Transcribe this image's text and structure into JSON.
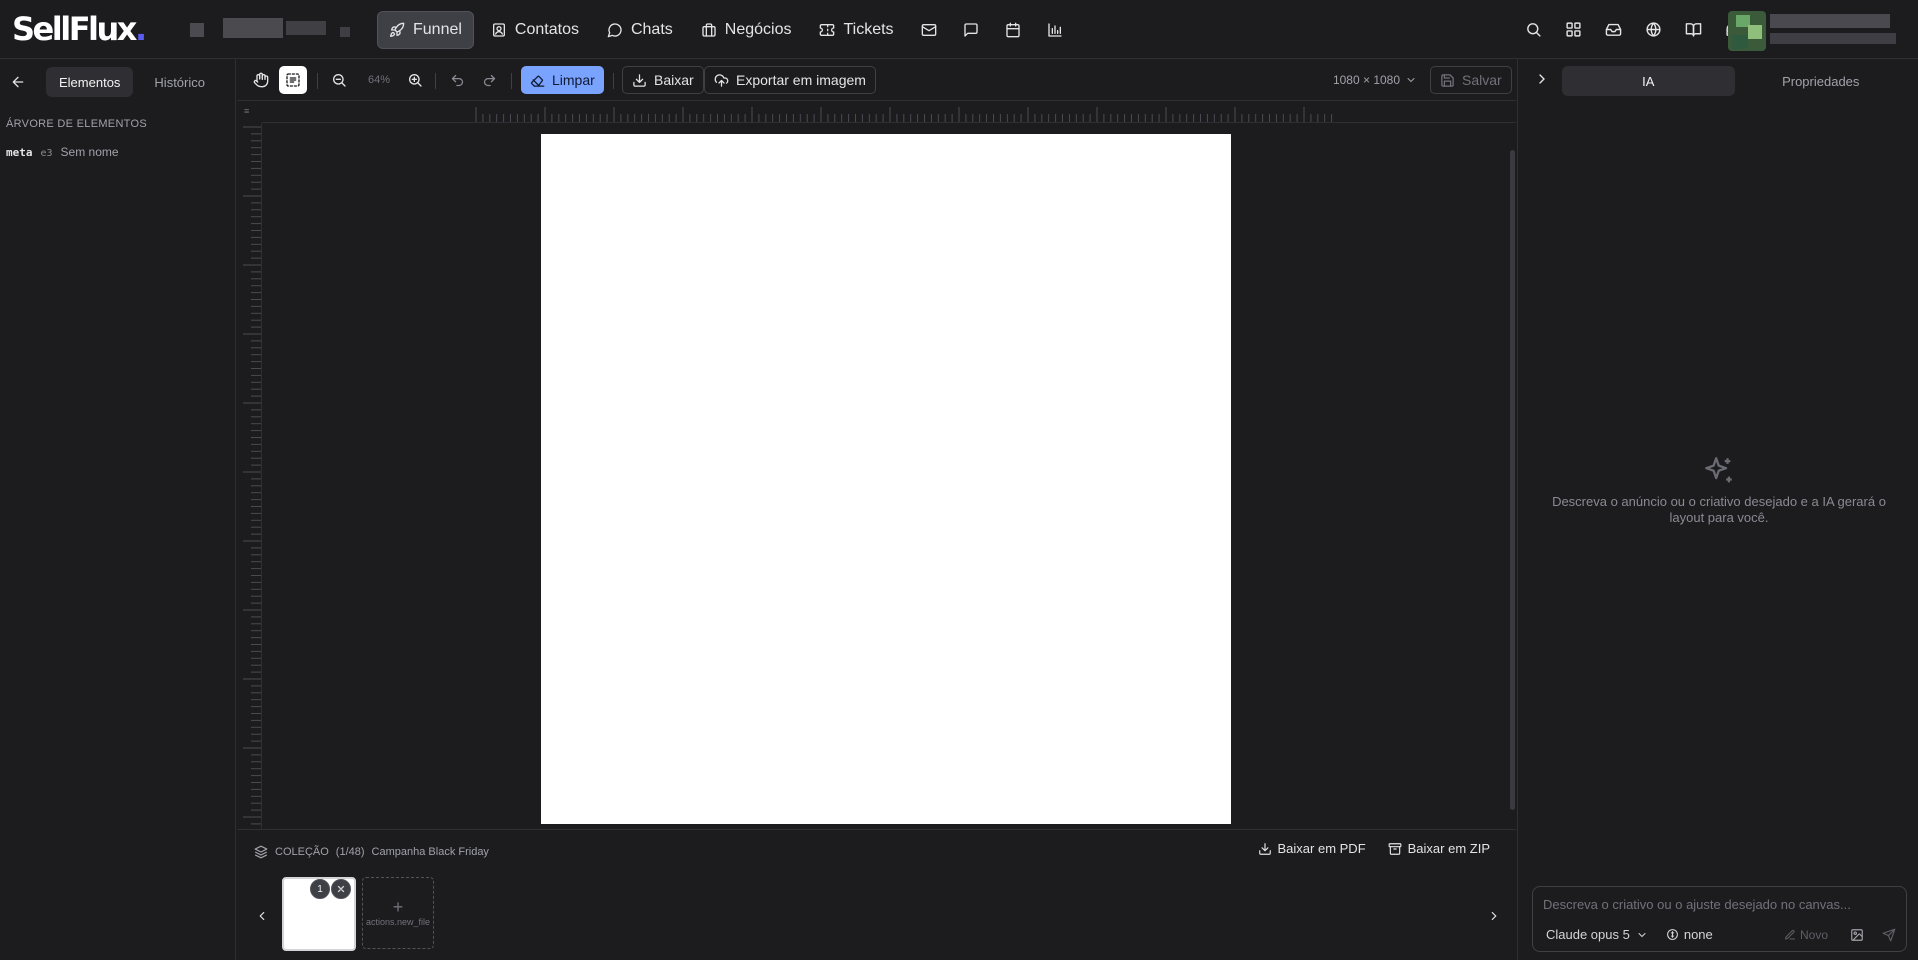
{
  "app": {
    "logo_text": "SellFlux",
    "logo_dot": "."
  },
  "nav": {
    "items": [
      {
        "label": "Funnel",
        "icon": "rocket-icon",
        "active": true
      },
      {
        "label": "Contatos",
        "icon": "contacts-icon"
      },
      {
        "label": "Chats",
        "icon": "chat-bubble-icon"
      },
      {
        "label": "Negócios",
        "icon": "briefcase-icon"
      },
      {
        "label": "Tickets",
        "icon": "ticket-icon"
      }
    ],
    "icon_items": [
      "mail-icon",
      "message-square-icon",
      "calendar-icon",
      "bar-chart-icon"
    ]
  },
  "header_right_icons": [
    "search-icon",
    "apps-grid-icon",
    "inbox-icon",
    "globe-icon",
    "book-icon",
    "headset-icon"
  ],
  "left_panel": {
    "tabs": [
      {
        "label": "Elementos",
        "active": true
      },
      {
        "label": "Histórico",
        "active": false
      }
    ],
    "section_title": "ÁRVORE DE ELEMENTOS",
    "tree": [
      {
        "tag": "meta",
        "id": "e3",
        "name": "Sem nome"
      }
    ]
  },
  "toolbar": {
    "zoom": "64%",
    "clear_label": "Limpar",
    "download_label": "Baixar",
    "export_label": "Exportar em imagem",
    "size_label": "1080 × 1080",
    "save_label": "Salvar"
  },
  "collection": {
    "title": "COLEÇÃO",
    "count": "(1/48)",
    "name": "Campanha Black Friday",
    "pdf_label": "Baixar em PDF",
    "zip_label": "Baixar em ZIP",
    "thumb_number": "1",
    "new_file_label": "actions.new_file"
  },
  "right_panel": {
    "tabs": [
      {
        "label": "IA",
        "active": true
      },
      {
        "label": "Propriedades",
        "active": false
      }
    ],
    "empty_text": "Descreva o anúncio ou o criativo desejado e a IA gerará o layout para você.",
    "prompt_placeholder": "Descreva o criativo ou o ajuste desejado no canvas...",
    "model_label": "Claude opus 5",
    "mode_label": "none",
    "new_label": "Novo"
  },
  "colors": {
    "accent": "#7aa2ff",
    "logo_dot": "#5b5bf0",
    "background": "#1c1c1f"
  }
}
